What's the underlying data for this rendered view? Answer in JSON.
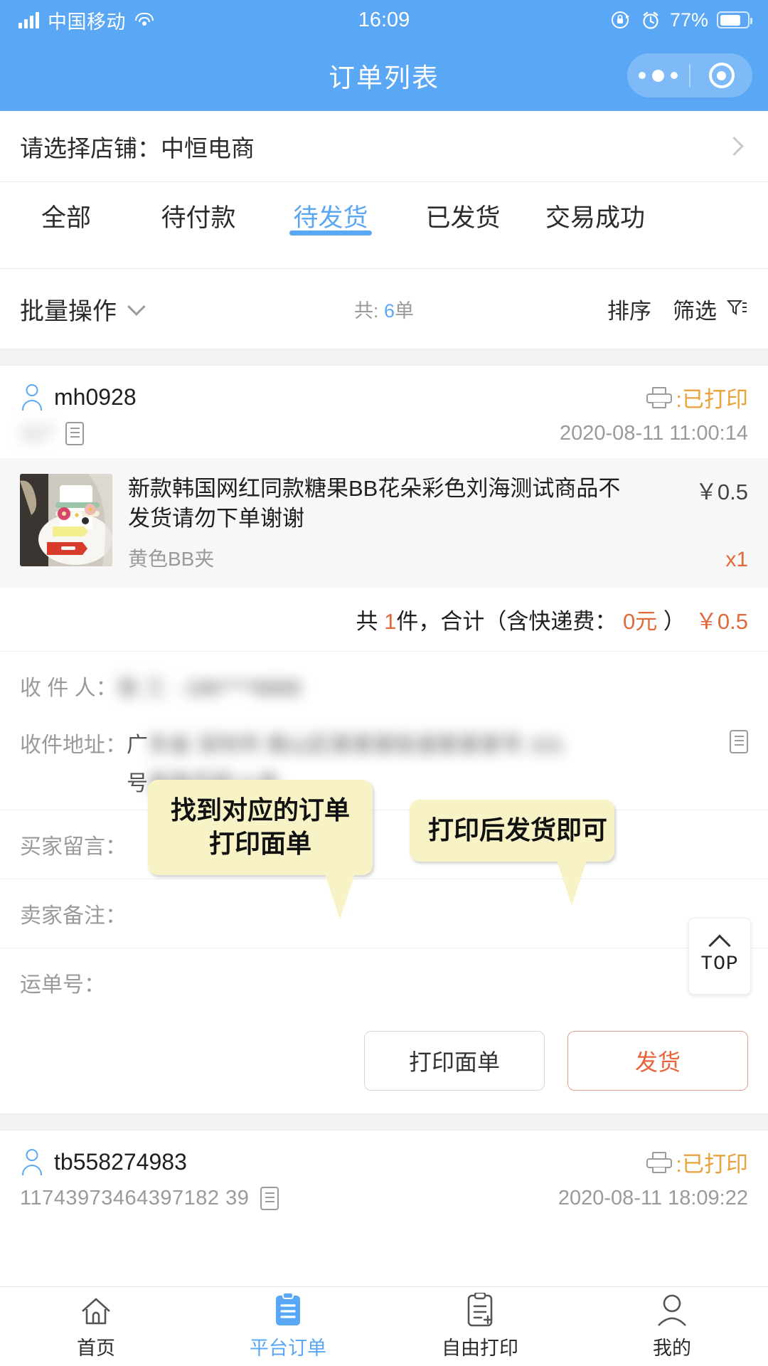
{
  "status_bar": {
    "carrier": "中国移动",
    "time": "16:09",
    "battery_pct": "77%",
    "icons": [
      "signal-icon",
      "wifi-icon",
      "rotation-lock-icon",
      "alarm-icon",
      "battery-icon"
    ]
  },
  "header": {
    "title": "订单列表",
    "capsule": [
      "more-icon",
      "target-icon"
    ]
  },
  "store": {
    "label": "请选择店铺：中恒电商"
  },
  "tabs": [
    {
      "label": "全部",
      "active": false
    },
    {
      "label": "待付款",
      "active": false
    },
    {
      "label": "待发货",
      "active": true
    },
    {
      "label": "已发货",
      "active": false
    },
    {
      "label": "交易成功",
      "active": false
    }
  ],
  "filter_bar": {
    "batch_label": "批量操作",
    "count_prefix": "共: ",
    "count_value": "6",
    "count_suffix": "单",
    "sort_label": "排序",
    "filter_label": "筛选"
  },
  "orders": [
    {
      "buyer": "mh0928",
      "print_status": ":已打印",
      "order_id": "117",
      "order_id_blurred": true,
      "date": "2020-08-11 11:00:14",
      "product": {
        "title": "新款韩国网红同款糖果BB花朵彩色刘海测试商品不发货请勿下单谢谢",
        "spec": "黄色BB夹",
        "price": "￥0.5",
        "qty": "x1"
      },
      "total": {
        "prefix": "共 ",
        "count": "1",
        "mid": "件，合计（含快递费：",
        "shipping": " 0元 ",
        "close": "）",
        "amount": "￥0.5"
      },
      "fields": {
        "recipient_label": "收 件 人：",
        "recipient_value": "张 三 · 186****8888",
        "address_label": "收件地址：",
        "address_value_prefix": "广",
        "address_value": "东省 深圳市 南山区某某某街道某某某号 101",
        "address_value_line2_prefix": "号",
        "address_value_line2": "某某花园 A 栋",
        "buyer_note_label": "买家留言：",
        "buyer_note_value": "",
        "seller_note_label": "卖家备注：",
        "seller_note_value": "",
        "tracking_label": "运单号：",
        "tracking_value": ""
      },
      "buttons": {
        "print": "打印面单",
        "ship": "发货"
      }
    },
    {
      "buyer": "tb558274983",
      "print_status": ":已打印",
      "order_id": "11743973464397182 39",
      "order_id_blurred": false,
      "date": "2020-08-11 18:09:22"
    }
  ],
  "annotations": [
    {
      "lines": [
        "找到对应的订单",
        "打印面单"
      ]
    },
    {
      "lines": [
        "打印后发货即可"
      ]
    }
  ],
  "top_button": {
    "label": "TOP"
  },
  "bottom_nav": [
    {
      "label": "首页",
      "icon": "home-icon",
      "active": false
    },
    {
      "label": "平台订单",
      "icon": "clipboard-icon",
      "active": true
    },
    {
      "label": "自由打印",
      "icon": "document-plus-icon",
      "active": false
    },
    {
      "label": "我的",
      "icon": "person-icon",
      "active": false
    }
  ],
  "colors": {
    "brand_blue": "#5aa7f5",
    "accent_orange": "#e8643c",
    "print_orange": "#e8a33d",
    "tip_yellow": "#f7f3c6"
  }
}
